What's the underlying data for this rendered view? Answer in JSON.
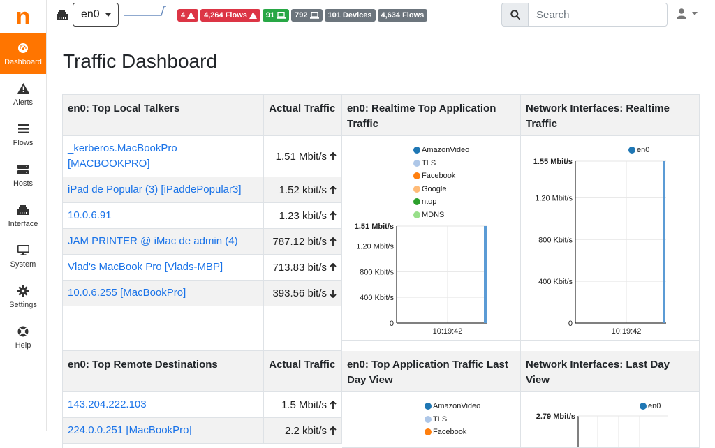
{
  "sidebar": {
    "logo": "n",
    "items": [
      {
        "label": "Dashboard",
        "icon": "gauge-icon",
        "active": true
      },
      {
        "label": "Alerts",
        "icon": "warning-icon"
      },
      {
        "label": "Flows",
        "icon": "flows-icon"
      },
      {
        "label": "Hosts",
        "icon": "server-icon"
      },
      {
        "label": "Interface",
        "icon": "ethernet-icon"
      },
      {
        "label": "System",
        "icon": "desktop-icon"
      },
      {
        "label": "Settings",
        "icon": "gear-icon"
      },
      {
        "label": "Help",
        "icon": "lifebuoy-icon"
      }
    ]
  },
  "topbar": {
    "interface": "en0",
    "badges": {
      "alerts": "4",
      "flows_alert": "4,264 Flows",
      "local_hosts": "91",
      "remote_hosts": "792",
      "devices": "101 Devices",
      "flows": "4,634 Flows"
    },
    "search_placeholder": "Search"
  },
  "colors": {
    "accent": "#ff7500",
    "link": "#1a73e8",
    "danger": "#dc3545",
    "success": "#28a745",
    "secondary": "#6c757d"
  },
  "page_title": "Traffic Dashboard",
  "top_local": {
    "header": "en0: Top Local Talkers",
    "traffic_header": "Actual Traffic",
    "rows": [
      {
        "host": "_kerberos.MacBookPro [MACBOOKPRO]",
        "traffic": "1.51 Mbit/s",
        "trend": "up"
      },
      {
        "host": "iPad de Popular (3) [iPaddePopular3]",
        "traffic": "1.52 kbit/s",
        "trend": "up"
      },
      {
        "host": "10.0.6.91",
        "traffic": "1.23 kbit/s",
        "trend": "up"
      },
      {
        "host": "JAM PRINTER @ iMac de admin (4)",
        "traffic": "787.12 bit/s",
        "trend": "up"
      },
      {
        "host": "Vlad's MacBook Pro [Vlads-MBP]",
        "traffic": "713.83 bit/s",
        "trend": "up"
      },
      {
        "host": "10.0.6.255 [MacBookPro]",
        "traffic": "393.56 bit/s",
        "trend": "down"
      }
    ]
  },
  "top_remote": {
    "header": "en0: Top Remote Destinations",
    "traffic_header": "Actual Traffic",
    "rows": [
      {
        "host": "143.204.222.103",
        "traffic": "1.5 Mbit/s",
        "trend": "up"
      },
      {
        "host": "224.0.0.251 [MacBookPro]",
        "traffic": "2.2 kbit/s",
        "trend": "up"
      }
    ]
  },
  "app_realtime": {
    "header": "en0: Realtime Top Application Traffic",
    "legend": [
      "AmazonVideo",
      "TLS",
      "Facebook",
      "Google",
      "ntop",
      "MDNS"
    ]
  },
  "iface_realtime": {
    "header": "Network Interfaces: Realtime Traffic",
    "legend": [
      "en0"
    ]
  },
  "app_lastday": {
    "header": "en0: Top Application Traffic Last Day View",
    "legend": [
      "AmazonVideo",
      "TLS",
      "Facebook"
    ]
  },
  "iface_lastday": {
    "header": "Network Interfaces: Last Day View",
    "legend": [
      "en0"
    ]
  },
  "chart_data": [
    {
      "type": "bar",
      "title": "en0: Realtime Top Application Traffic",
      "series": [
        {
          "name": "AmazonVideo",
          "values": [
            1.51
          ]
        }
      ],
      "categories": [
        "10:19:42"
      ],
      "yticks": [
        "0",
        "400 Kbit/s",
        "800 Kbit/s",
        "1.20 Mbit/s",
        "1.51 Mbit/s"
      ],
      "ylim_mbit": [
        0,
        1.51
      ]
    },
    {
      "type": "bar",
      "title": "Network Interfaces: Realtime Traffic",
      "series": [
        {
          "name": "en0",
          "values": [
            1.55
          ]
        }
      ],
      "categories": [
        "10:19:42"
      ],
      "yticks": [
        "0",
        "400 Kbit/s",
        "800 Kbit/s",
        "1.20 Mbit/s",
        "1.55 Mbit/s"
      ],
      "ylim_mbit": [
        0,
        1.55
      ]
    },
    {
      "type": "area",
      "title": "Network Interfaces: Last Day View",
      "series": [
        {
          "name": "en0"
        }
      ],
      "yticks": [
        "2.79 Mbit/s"
      ]
    }
  ],
  "series_colors": [
    "#1f77b4",
    "#aec7e8",
    "#ff7f0e",
    "#ffbb78",
    "#2ca02c",
    "#98df8a"
  ]
}
